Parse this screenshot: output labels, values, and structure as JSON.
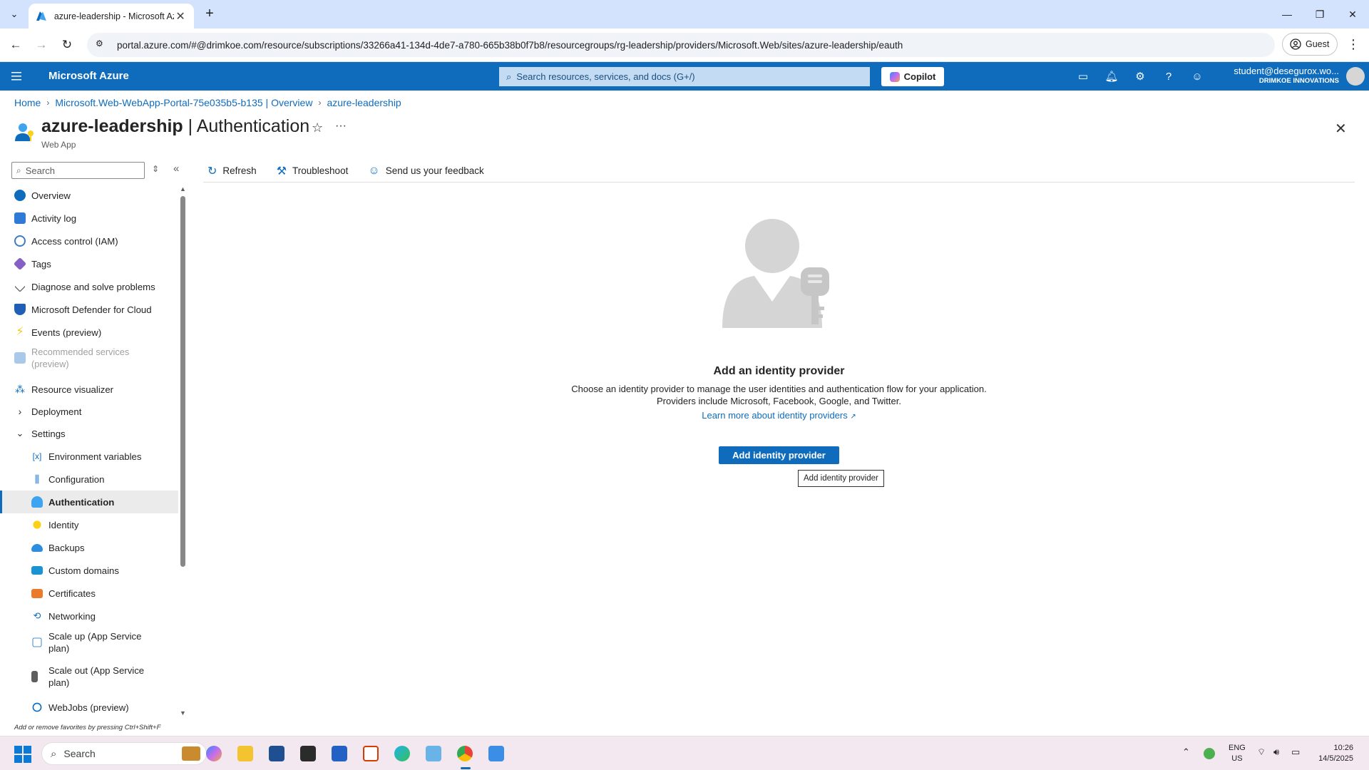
{
  "browser": {
    "tab_title": "azure-leadership - Microsoft Azure",
    "url": "portal.azure.com/#@drimkoe.com/resource/subscriptions/33266a41-134d-4de7-a780-665b38b0f7b8/resourcegroups/rg-leadership/providers/Microsoft.Web/sites/azure-leadership/eauth",
    "profile_label": "Guest"
  },
  "azure_header": {
    "brand": "Microsoft Azure",
    "search_placeholder": "Search resources, services, and docs (G+/)",
    "copilot_label": "Copilot",
    "user_email": "student@desegurox.wo...",
    "user_org": "DRIMKOE INNOVATIONS"
  },
  "breadcrumb": [
    "Home",
    "Microsoft.Web-WebApp-Portal-75e035b5-b135 | Overview",
    "azure-leadership"
  ],
  "page": {
    "resource_name": "azure-leadership",
    "title_suffix": " | Authentication",
    "subtitle": "Web App"
  },
  "nav": {
    "search_placeholder": "Search",
    "items": [
      {
        "label": "Overview",
        "icon": "globe-icon"
      },
      {
        "label": "Activity log",
        "icon": "activity-log-icon"
      },
      {
        "label": "Access control (IAM)",
        "icon": "people-icon"
      },
      {
        "label": "Tags",
        "icon": "tag-icon"
      },
      {
        "label": "Diagnose and solve problems",
        "icon": "wrench-icon"
      },
      {
        "label": "Microsoft Defender for Cloud",
        "icon": "shield-icon"
      },
      {
        "label": "Events (preview)",
        "icon": "lightning-icon"
      },
      {
        "label": "Recommended services (preview)",
        "icon": "grid-icon"
      },
      {
        "label": "Resource visualizer",
        "icon": "hierarchy-icon"
      },
      {
        "label": "Deployment",
        "icon": "chevron-right-icon"
      },
      {
        "label": "Settings",
        "icon": "chevron-down-icon"
      },
      {
        "label": "Environment variables",
        "icon": "variable-icon"
      },
      {
        "label": "Configuration",
        "icon": "sliders-icon"
      },
      {
        "label": "Authentication",
        "icon": "person-key-icon"
      },
      {
        "label": "Identity",
        "icon": "key-icon"
      },
      {
        "label": "Backups",
        "icon": "cloud-icon"
      },
      {
        "label": "Custom domains",
        "icon": "domain-icon"
      },
      {
        "label": "Certificates",
        "icon": "certificate-icon"
      },
      {
        "label": "Networking",
        "icon": "network-icon"
      },
      {
        "label": "Scale up (App Service plan)",
        "icon": "scale-up-icon"
      },
      {
        "label": "Scale out (App Service plan)",
        "icon": "scale-out-icon"
      },
      {
        "label": "WebJobs (preview)",
        "icon": "webjobs-icon"
      }
    ],
    "favorites_hint": "Add or remove favorites by pressing Ctrl+Shift+F"
  },
  "commands": {
    "refresh": "Refresh",
    "troubleshoot": "Troubleshoot",
    "feedback": "Send us your feedback"
  },
  "empty_state": {
    "title": "Add an identity provider",
    "desc_line1": "Choose an identity provider to manage the user identities and authentication flow for your application.",
    "desc_line2": "Providers include Microsoft, Facebook, Google, and Twitter.",
    "link": "Learn more about identity providers",
    "button": "Add identity provider",
    "tooltip": "Add identity provider"
  },
  "taskbar": {
    "search_placeholder": "Search",
    "lang_line1": "ENG",
    "lang_line2": "US",
    "time": "10:26",
    "date": "14/5/2025"
  },
  "colors": {
    "azure_blue": "#0f6cbd",
    "tab_strip": "#d3e3fd",
    "taskbar": "#f3e8f0"
  }
}
